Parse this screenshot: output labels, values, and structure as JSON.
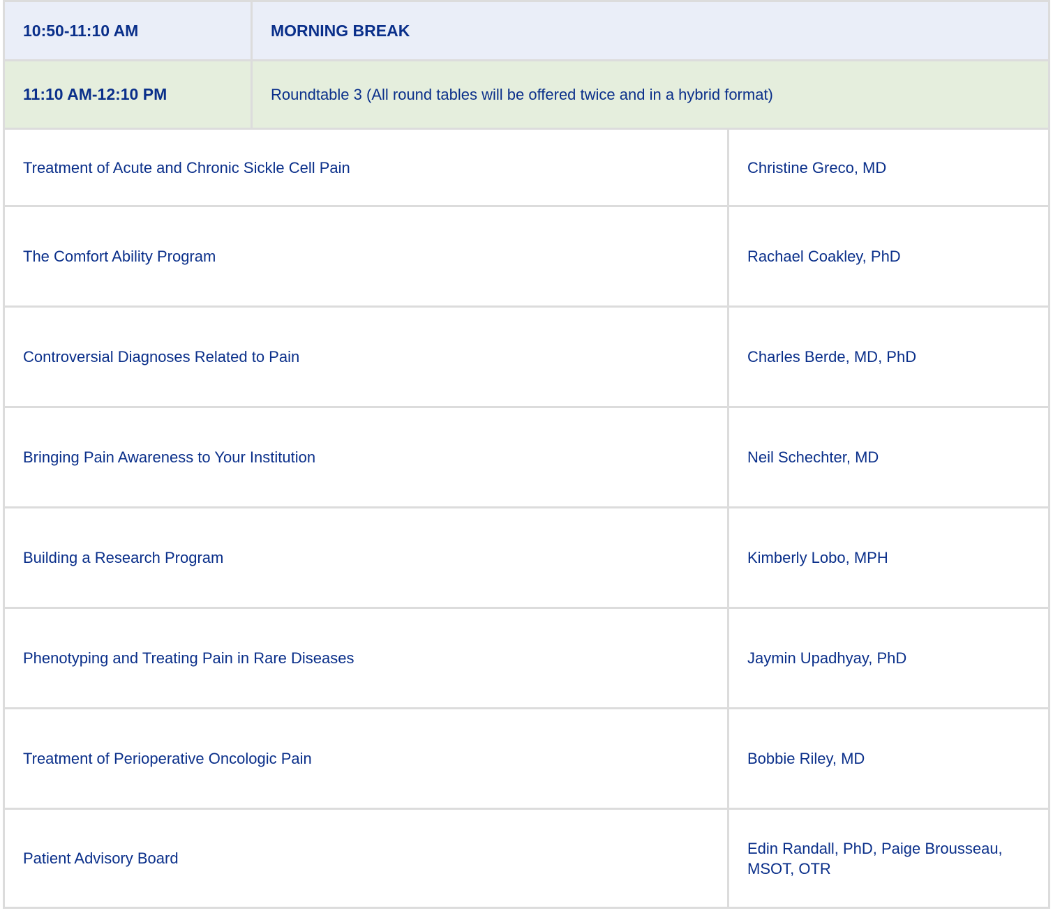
{
  "schedule": {
    "break_row": {
      "time": "10:50-11:10 AM",
      "title": "MORNING BREAK"
    },
    "roundtable_row": {
      "time": "11:10 AM-12:10 PM",
      "title": "Roundtable 3 (All round tables will be offered twice and in a hybrid format)"
    },
    "sessions": [
      {
        "topic": "Treatment of Acute and Chronic Sickle Cell Pain",
        "speaker": "Christine Greco, MD"
      },
      {
        "topic": "The Comfort Ability Program",
        "speaker": "Rachael Coakley, PhD"
      },
      {
        "topic": "Controversial Diagnoses Related to Pain",
        "speaker": "Charles Berde, MD, PhD"
      },
      {
        "topic": "Bringing Pain Awareness to Your Institution",
        "speaker": "Neil Schechter, MD"
      },
      {
        "topic": "Building a Research Program",
        "speaker": "Kimberly Lobo, MPH"
      },
      {
        "topic": "Phenotyping and Treating Pain in Rare Diseases",
        "speaker": "Jaymin Upadhyay, PhD"
      },
      {
        "topic": "Treatment of Perioperative Oncologic Pain",
        "speaker": "Bobbie Riley, MD"
      },
      {
        "topic": "Patient Advisory Board",
        "speaker": "Edin Randall, PhD, Paige Brousseau, MSOT, OTR"
      }
    ]
  },
  "colors": {
    "text": "#0a2f8a",
    "break_bg": "#eaeef8",
    "roundtable_bg": "#e5eedd",
    "border": "#dcdcdc"
  }
}
